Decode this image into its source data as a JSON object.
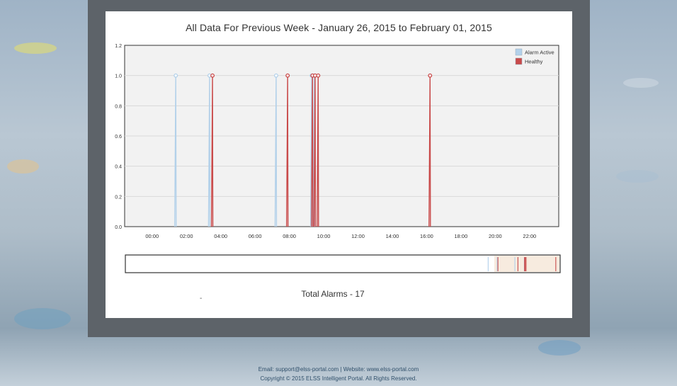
{
  "chart_data": {
    "type": "line",
    "title": "All Data For Previous Week - January 26, 2015 to February 01, 2015",
    "ylim": [
      0,
      1.2
    ],
    "yticks": [
      "0.0",
      "0.2",
      "0.4",
      "0.6",
      "0.8",
      "1.0",
      "1.2"
    ],
    "xlim": [
      -1.6,
      23.7
    ],
    "xticks": [
      "00:00",
      "02:00",
      "04:00",
      "06:00",
      "08:00",
      "10:00",
      "12:00",
      "14:00",
      "16:00",
      "18:00",
      "20:00",
      "22:00"
    ],
    "legend_position": "top-right",
    "grid": true,
    "series": [
      {
        "name": "Alarm Active",
        "color": "#b3d1ea",
        "events": [
          1.38,
          3.35,
          7.23,
          9.3,
          9.45
        ]
      },
      {
        "name": "Healthy",
        "color": "#c94a4a",
        "events": [
          3.52,
          7.9,
          9.35,
          9.5,
          9.68,
          16.2
        ]
      }
    ]
  },
  "navigator": {
    "label": "range-navigator"
  },
  "summary": {
    "total_alarms": "Total Alarms - 17",
    "dash": "-"
  },
  "footer": {
    "contact": "Email: support@elss-portal.com   |   Website: www.elss-portal.com",
    "copyright": "Copyright © 2015 ELSS Intelligent Portal. All Rights Reserved."
  }
}
